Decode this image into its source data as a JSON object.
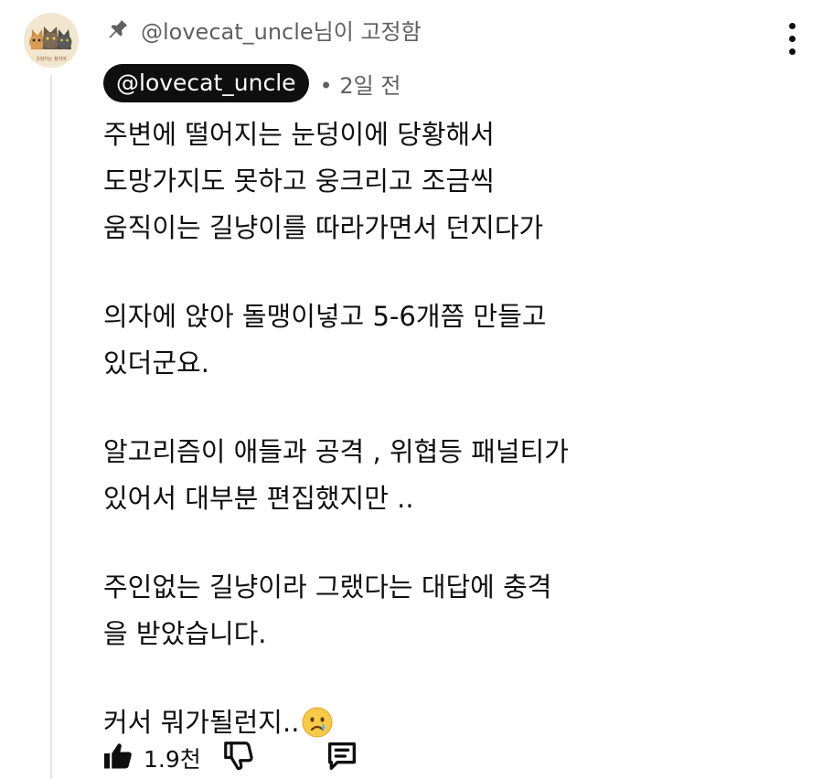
{
  "pinned": {
    "text": "@lovecat_uncle님이 고정함"
  },
  "author": {
    "handle": "@lovecat_uncle",
    "avatar_caption": "고양이는 참치야"
  },
  "meta": {
    "separator": "•",
    "time": "2일 전"
  },
  "comment": {
    "paragraphs": [
      {
        "lines": [
          "주변에 떨어지는 눈덩이에 당황해서",
          "도망가지도 못하고 웅크리고 조금씩",
          "움직이는 길냥이를 따라가면서 던지다가"
        ]
      },
      {
        "lines": [
          "의자에 앉아 돌맹이넣고 5-6개쯤 만들고",
          "있더군요."
        ]
      },
      {
        "lines": [
          "알고리즘이 애들과 공격 , 위협등 패널티가",
          "있어서 대부분 편집했지만 .."
        ]
      },
      {
        "lines": [
          "주인없는 길냥이라 그랬다는 대답에 충격",
          "을 받았습니다."
        ]
      },
      {
        "lines": [
          "커서 뭐가될런지.."
        ]
      }
    ],
    "trailing_emoji": "crying-face-emoji"
  },
  "actions": {
    "like_count": "1.9천",
    "icons": [
      "thumbs-up-icon",
      "thumbs-down-icon",
      "reply-icon",
      "more-vertical-icon",
      "pin-icon"
    ]
  }
}
